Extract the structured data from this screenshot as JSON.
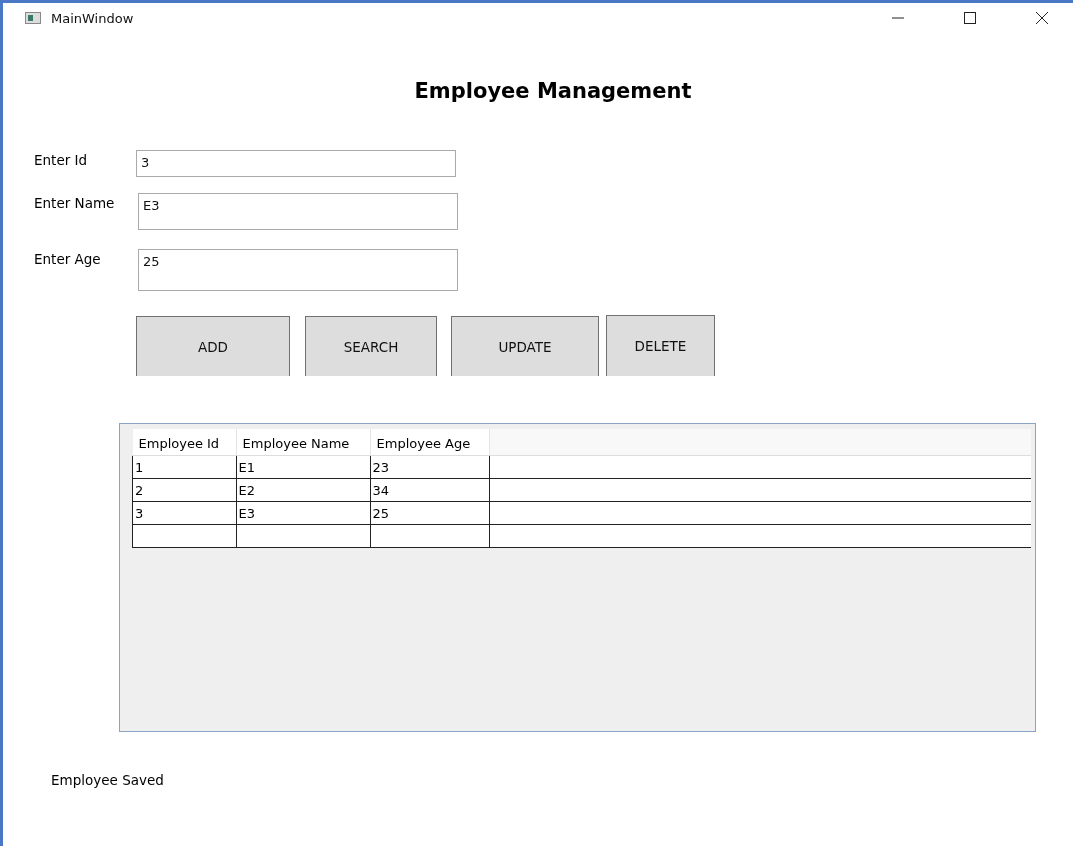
{
  "window": {
    "title": "MainWindow"
  },
  "heading": "Employee Management",
  "fields": [
    {
      "label": "Enter Id",
      "value": "3"
    },
    {
      "label": "Enter Name",
      "value": "E3"
    },
    {
      "label": "Enter Age",
      "value": "25"
    }
  ],
  "buttons": [
    "ADD",
    "SEARCH",
    "UPDATE",
    "DELETE"
  ],
  "table": {
    "columns": [
      "Employee Id",
      "Employee Name",
      "Employee Age"
    ],
    "rows": [
      [
        "1",
        "E1",
        "23"
      ],
      [
        "2",
        "E2",
        "34"
      ],
      [
        "3",
        "E3",
        "25"
      ],
      [
        "",
        "",
        ""
      ]
    ]
  },
  "status_bar": "Employee Saved"
}
